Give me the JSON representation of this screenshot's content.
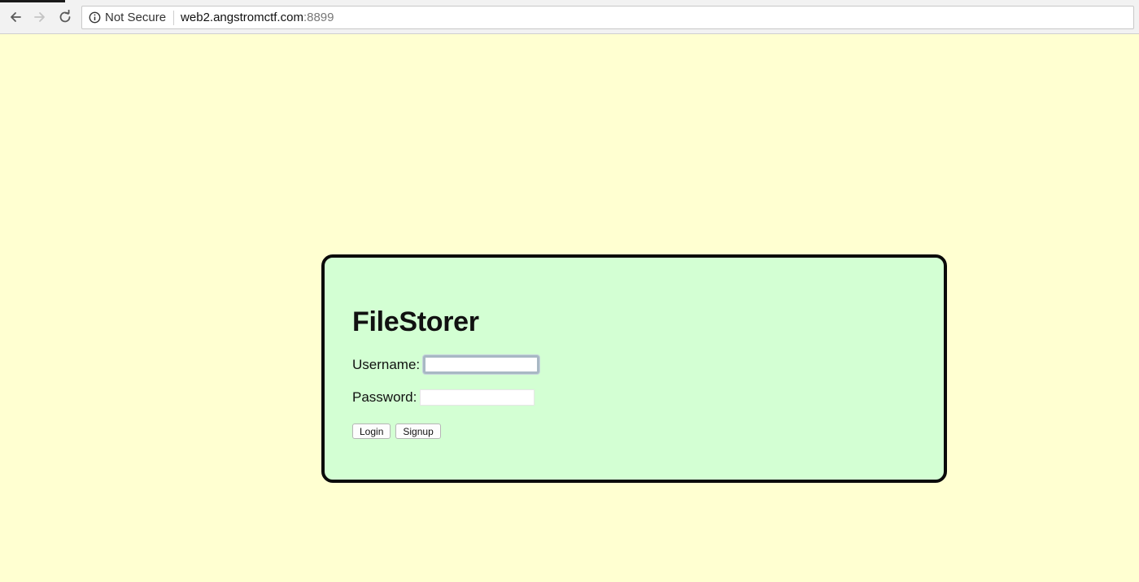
{
  "browser": {
    "security_label": "Not Secure",
    "url_host": "web2.angstromctf.com",
    "url_port": ":8899",
    "icons": {
      "back": "back-arrow-icon",
      "forward": "forward-arrow-icon",
      "reload": "reload-icon",
      "info": "info-icon"
    }
  },
  "page": {
    "title": "FileStorer",
    "username_label": "Username:",
    "username_value": "",
    "password_label": "Password:",
    "password_value": "",
    "login_label": "Login",
    "signup_label": "Signup"
  },
  "colors": {
    "page_background": "#ffffd1",
    "panel_background": "#d3ffd3",
    "panel_border": "#0a0a0a"
  }
}
